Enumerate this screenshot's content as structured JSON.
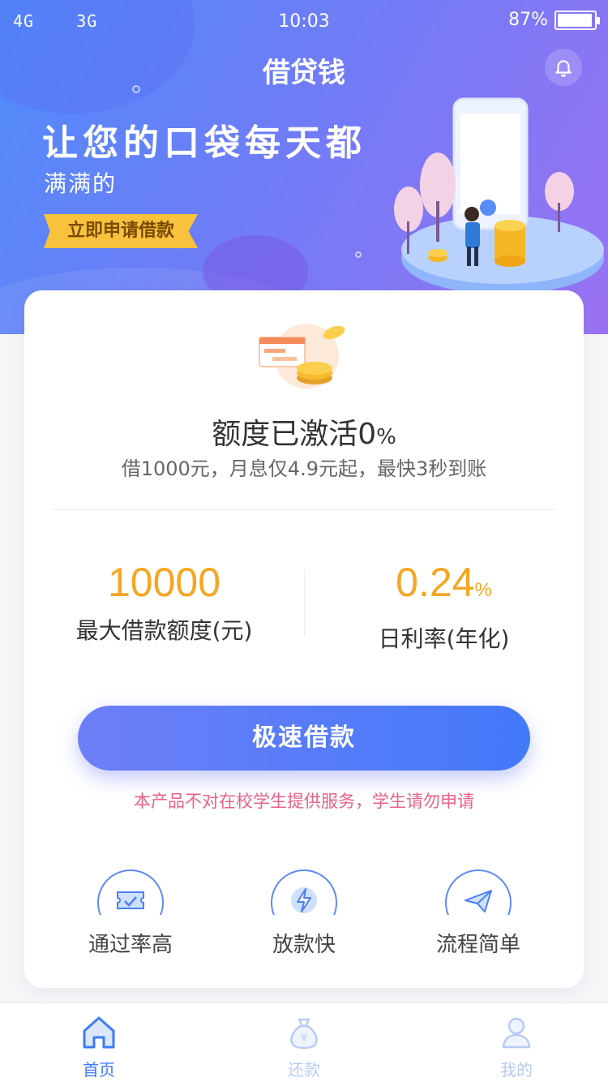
{
  "status_bar": {
    "signal": "4G     3G",
    "time": "10:03",
    "battery": "87%"
  },
  "header": {
    "title": "借贷钱",
    "slogan_line1": "让您的口袋每天都",
    "slogan_line2": "满满的",
    "apply_tag": "立即申请借款"
  },
  "card": {
    "quota_title": "额度已激活0",
    "quota_pct": "%",
    "quota_sub": "借1000元，月息仅4.9元起，最快3秒到账",
    "stats": {
      "max_amount": {
        "value": "10000",
        "label": "最大借款额度(元)"
      },
      "daily_rate": {
        "value": "0.24",
        "unit": "%",
        "label": "日利率(年化)"
      }
    },
    "cta_label": "极速借款",
    "notice": "本产品不对在校学生提供服务，学生请勿申请",
    "features": [
      {
        "label": "通过率高",
        "icon": "ticket-check-icon"
      },
      {
        "label": "放款快",
        "icon": "lightning-icon"
      },
      {
        "label": "流程简单",
        "icon": "paper-plane-icon"
      }
    ]
  },
  "tabbar": {
    "items": [
      {
        "label": "首页",
        "icon": "home-icon",
        "active": true
      },
      {
        "label": "还款",
        "icon": "money-bag-icon",
        "active": false
      },
      {
        "label": "我的",
        "icon": "user-icon",
        "active": false
      }
    ]
  },
  "colors": {
    "accent": "#f6a623",
    "primary": "#4379fa",
    "notice": "#e8628a",
    "tag": "#f9c23c"
  }
}
